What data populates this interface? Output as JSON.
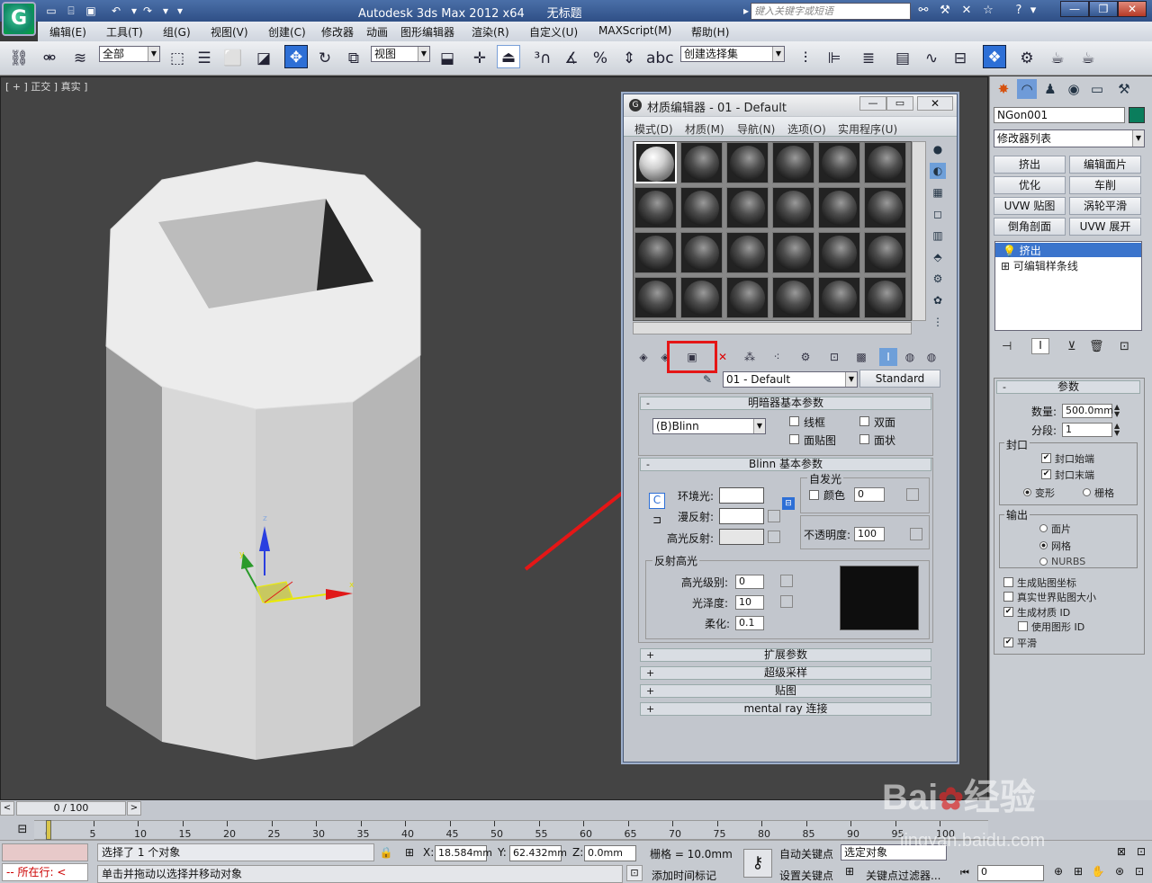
{
  "app": {
    "title": "Autodesk 3ds Max  2012 x64",
    "doc_title": "无标题",
    "search_placeholder": "键入关键字或短语"
  },
  "menu": [
    "编辑(E)",
    "工具(T)",
    "组(G)",
    "视图(V)",
    "创建(C)",
    "修改器",
    "动画",
    "图形编辑器",
    "渲染(R)",
    "自定义(U)",
    "MAXScript(M)",
    "帮助(H)"
  ],
  "toolbar": {
    "filter_select": "全部",
    "ref_coord": "视图",
    "selection_set": "创建选择集"
  },
  "viewport": {
    "label": "[ + ] 正交 ] 真实 ]",
    "axis_x": "x",
    "axis_y": "y",
    "axis_z": "z"
  },
  "command_panel": {
    "object_name": "NGon001",
    "modifier_list": "修改器列表",
    "buttons": [
      "挤出",
      "编辑面片",
      "优化",
      "车削",
      "UVW 贴图",
      "涡轮平滑",
      "倒角剖面",
      "UVW 展开"
    ],
    "stack": [
      "挤出",
      "可编辑样条线"
    ],
    "params_title": "参数",
    "amount_label": "数量:",
    "amount_value": "500.0mm",
    "segments_label": "分段:",
    "segments_value": "1",
    "capping_title": "封口",
    "cap_start": "封口始端",
    "cap_end": "封口末端",
    "morph": "变形",
    "grid": "栅格",
    "output_title": "输出",
    "out_patch": "面片",
    "out_mesh": "网格",
    "out_nurbs": "NURBS",
    "gen_mapping": "生成贴图坐标",
    "real_world": "真实世界贴图大小",
    "gen_mat_id": "生成材质 ID",
    "use_shape_id": "使用图形 ID",
    "smooth": "平滑"
  },
  "material_editor": {
    "title": "材质编辑器 - 01 - Default",
    "menu": [
      "模式(D)",
      "材质(M)",
      "导航(N)",
      "选项(O)",
      "实用程序(U)"
    ],
    "material_name": "01 - Default",
    "material_type": "Standard",
    "shader_rollout": "明暗器基本参数",
    "shader_type": "(B)Blinn",
    "wire": "线框",
    "two_sided": "双面",
    "face_map": "面贴图",
    "faceted": "面状",
    "blinn_rollout": "Blinn 基本参数",
    "self_illum": "自发光",
    "color": "颜色",
    "self_illum_value": "0",
    "ambient": "环境光:",
    "diffuse": "漫反射:",
    "specular": "高光反射:",
    "opacity": "不透明度:",
    "opacity_value": "100",
    "spec_highlights": "反射高光",
    "spec_level": "高光级别:",
    "spec_level_value": "0",
    "glossiness": "光泽度:",
    "glossiness_value": "10",
    "soften": "柔化:",
    "soften_value": "0.1",
    "rollouts": [
      "扩展参数",
      "超级采样",
      "贴图",
      "mental ray 连接"
    ]
  },
  "timeline": {
    "frame": "0 / 100",
    "ticks": [
      "0",
      "5",
      "10",
      "15",
      "20",
      "25",
      "30",
      "35",
      "40",
      "45",
      "50",
      "55",
      "60",
      "65",
      "70",
      "75",
      "80",
      "85",
      "90",
      "95",
      "100"
    ]
  },
  "status": {
    "running": "所在行:",
    "selected": "选择了 1 个对象",
    "hint": "单击并拖动以选择并移动对象",
    "x_label": "X:",
    "x_value": "18.584mm",
    "y_label": "Y:",
    "y_value": "62.432mm",
    "z_label": "Z:",
    "z_value": "0.0mm",
    "grid": "栅格 = 10.0mm",
    "add_time_tag": "添加时间标记",
    "auto_key": "自动关键点",
    "selected_obj": "选定对象",
    "set_key": "设置关键点",
    "key_filters": "关键点过滤器...",
    "frame_field": "0"
  },
  "watermark": {
    "brand": "Bai",
    "brand2": "经验",
    "url": "jingyan.baidu.com"
  }
}
